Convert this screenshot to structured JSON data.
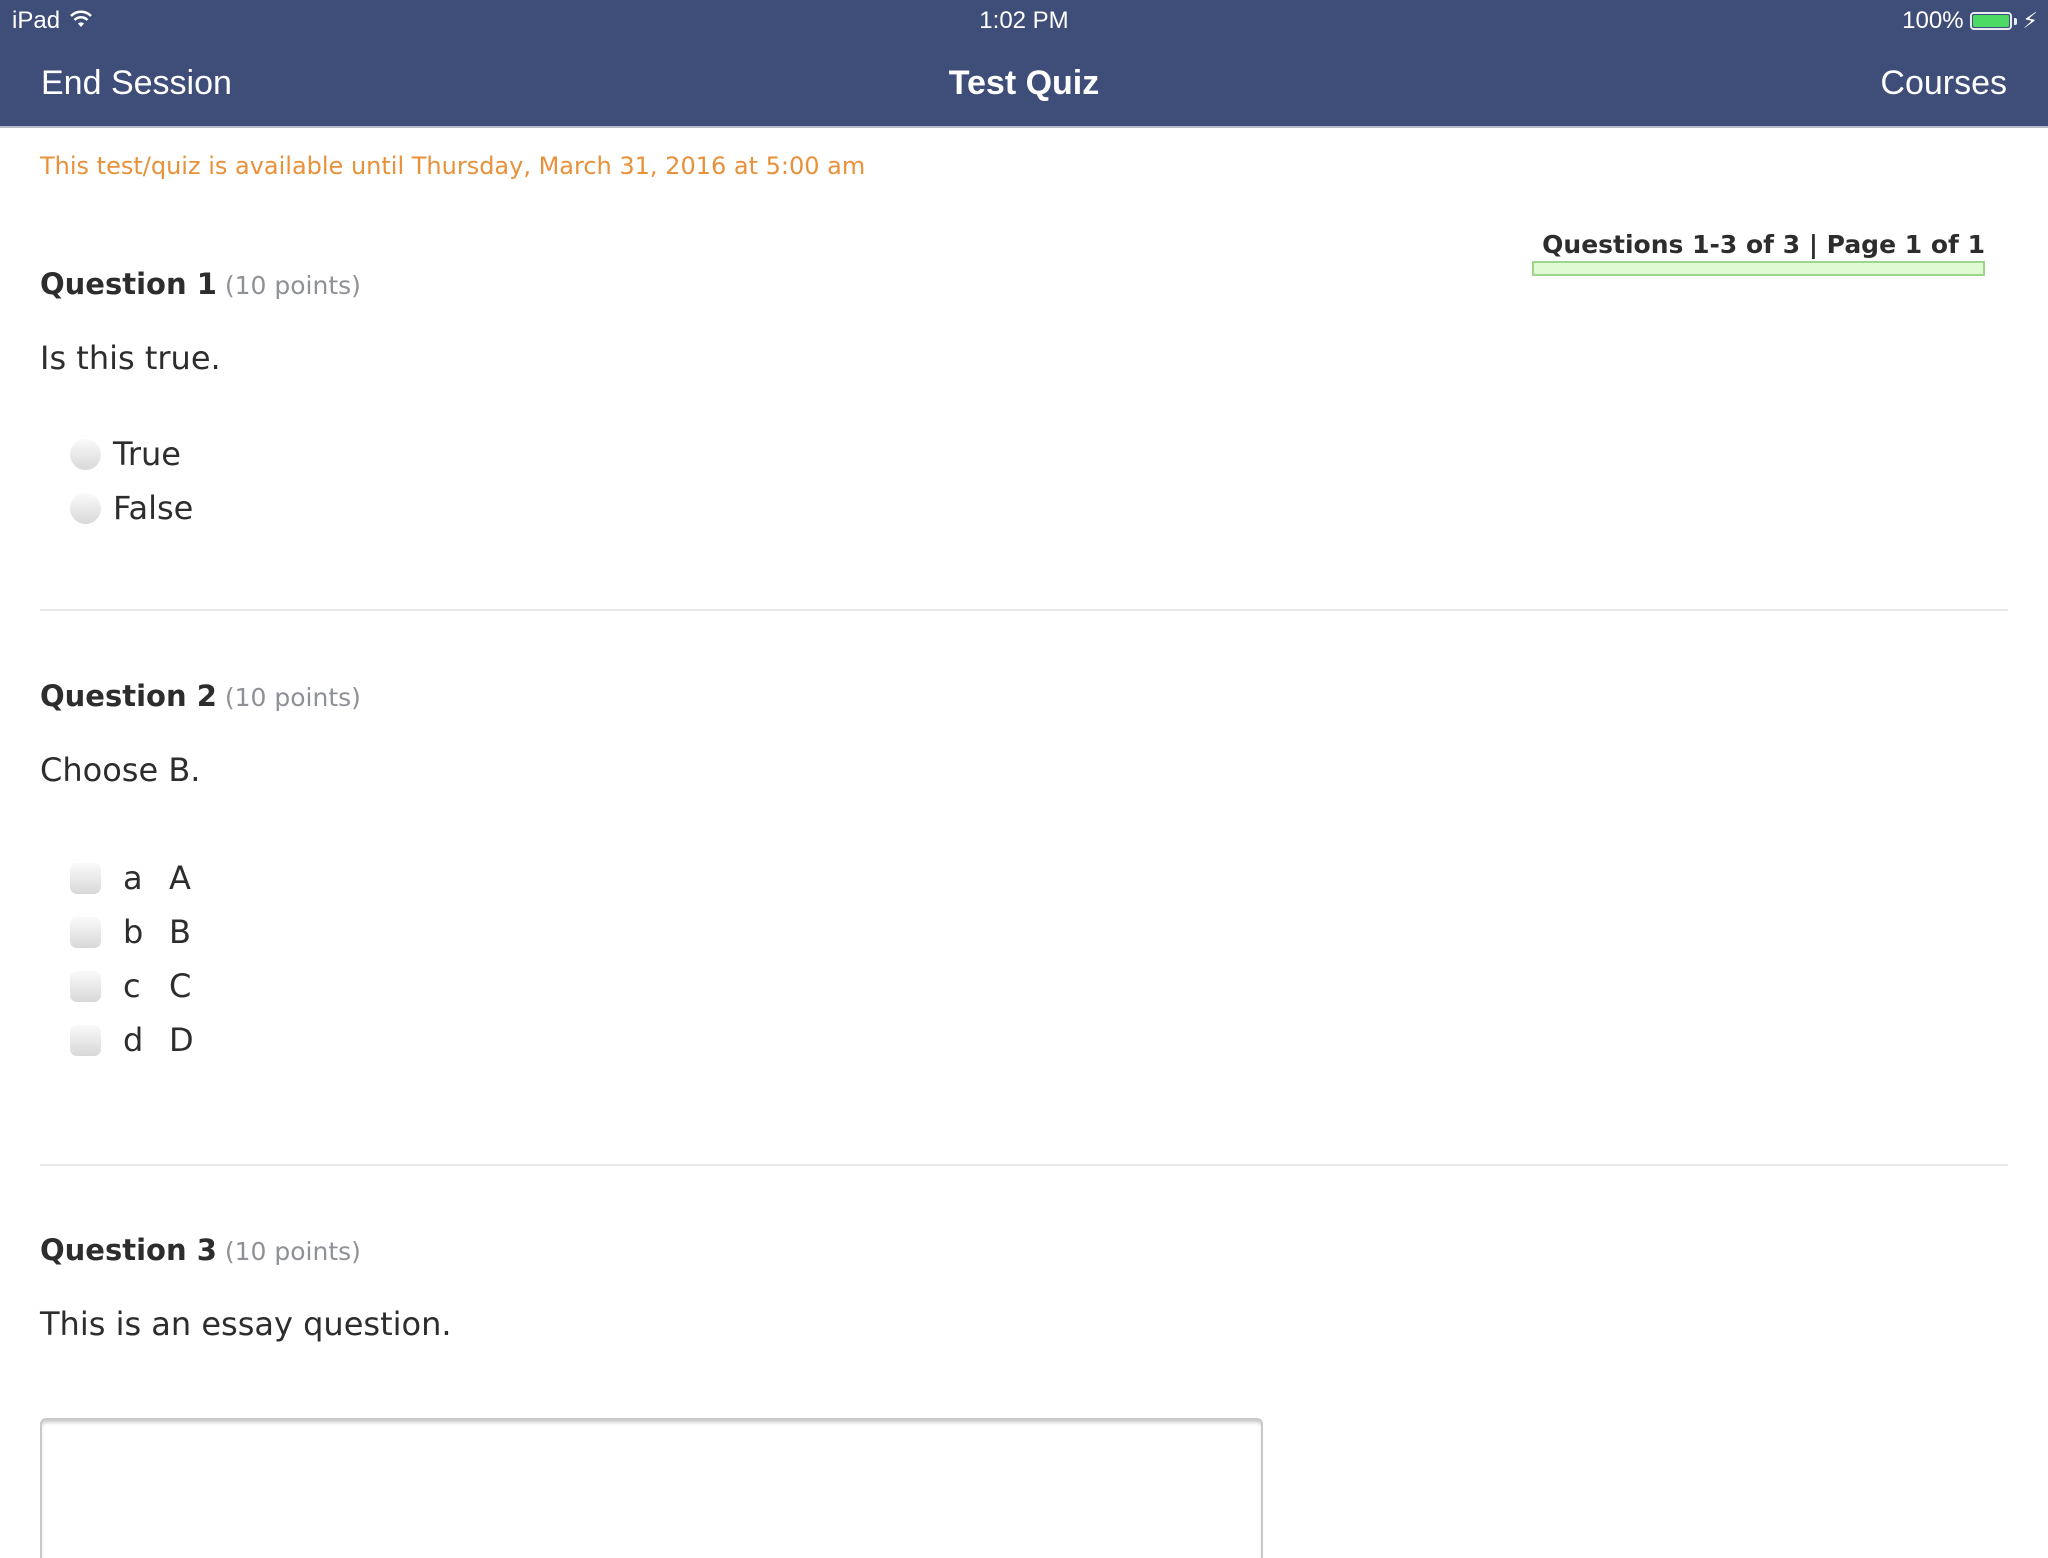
{
  "status_bar": {
    "device": "iPad",
    "wifi_icon": "wifi-icon",
    "time": "1:02 PM",
    "battery_percent": "100%",
    "battery_level": 1.0,
    "battery_icon": "battery-icon",
    "charging_icon": "charging-bolt-icon"
  },
  "nav": {
    "left_button": "End Session",
    "title": "Test Quiz",
    "right_button": "Courses",
    "bar_color": "#3f4e78"
  },
  "notice": {
    "text": "This test/quiz is available until Thursday, March 31, 2016 at 5:00 am",
    "color": "#e8913a"
  },
  "pagination": {
    "text": "Questions 1-3 of 3 | Page 1 of 1",
    "progress": 0
  },
  "questions": [
    {
      "number": "Question 1",
      "points": "(10 points)",
      "text": "Is this true.",
      "type": "radio",
      "options": [
        {
          "label": "True",
          "selected": false
        },
        {
          "label": "False",
          "selected": false
        }
      ]
    },
    {
      "number": "Question 2",
      "points": "(10 points)",
      "text": "Choose B.",
      "type": "checkbox",
      "options": [
        {
          "letter": "a",
          "label": "A",
          "selected": false
        },
        {
          "letter": "b",
          "label": "B",
          "selected": false
        },
        {
          "letter": "c",
          "label": "C",
          "selected": false
        },
        {
          "letter": "d",
          "label": "D",
          "selected": false
        }
      ]
    },
    {
      "number": "Question 3",
      "points": "(10 points)",
      "text": "This is an essay question.",
      "type": "essay",
      "answer": ""
    }
  ]
}
